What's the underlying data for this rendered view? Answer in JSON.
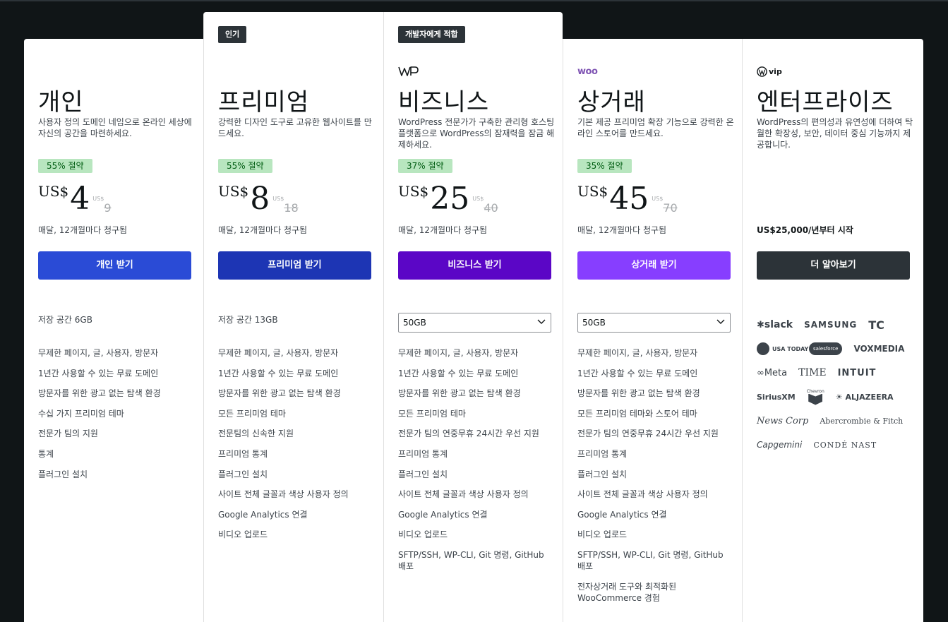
{
  "plans": [
    {
      "badge": "",
      "name": "개인",
      "description": "사용자 정의 도메인 네임으로 온라인 세상에 자신의 공간을 마련하세요.",
      "savings": "55% 절약",
      "currency": "US$",
      "price": "4",
      "old_currency": "US$",
      "old_price": "9",
      "billing": "매달, 12개월마다 청구됨",
      "cta": "개인 받기",
      "cta_color": "#2a4bd6",
      "storage": "저장 공간 6GB",
      "features": [
        "무제한 페이지, 글, 사용자, 방문자",
        "1년간 사용할 수 있는 무료 도메인",
        "방문자를 위한 광고 없는 탐색 환경",
        "수십 가지 프리미엄 테마",
        "전문가 팀의 지원",
        "통계",
        "플러그인 설치"
      ]
    },
    {
      "badge": "인기",
      "name": "프리미엄",
      "description": "강력한 디자인 도구로 고유한 웹사이트를 만드세요.",
      "savings": "55% 절약",
      "currency": "US$",
      "price": "8",
      "old_currency": "US$",
      "old_price": "18",
      "billing": "매달, 12개월마다 청구됨",
      "cta": "프리미엄 받기",
      "cta_color": "#1d35b4",
      "storage": "저장 공간 13GB",
      "features": [
        "무제한 페이지, 글, 사용자, 방문자",
        "1년간 사용할 수 있는 무료 도메인",
        "방문자를 위한 광고 없는 탐색 환경",
        "모든 프리미엄 테마",
        "전문팀의 신속한 지원",
        "프리미엄 통계",
        "플러그인 설치",
        "사이트 전체 글꼴과 색상 사용자 정의",
        "Google Analytics 연결",
        "비디오 업로드"
      ]
    },
    {
      "badge": "개발자에게 적합",
      "name": "비즈니스",
      "description": "WordPress 전문가가 구축한 관리형 호스팅 플랫폼으로 WordPress의 잠재력을 잠금 해제하세요.",
      "savings": "37% 절약",
      "currency": "US$",
      "price": "25",
      "old_currency": "US$",
      "old_price": "40",
      "billing": "매달, 12개월마다 청구됨",
      "cta": "비즈니스 받기",
      "cta_color": "#5b06c6",
      "storage_select": "50GB",
      "features": [
        "무제한 페이지, 글, 사용자, 방문자",
        "1년간 사용할 수 있는 무료 도메인",
        "방문자를 위한 광고 없는 탐색 환경",
        "모든 프리미엄 테마",
        "전문가 팀의 연중무휴 24시간 우선 지원",
        "프리미엄 통계",
        "플러그인 설치",
        "사이트 전체 글꼴과 색상 사용자 정의",
        "Google Analytics 연결",
        "비디오 업로드",
        "SFTP/SSH, WP-CLI, Git 명령, GitHub 배포"
      ]
    },
    {
      "badge": "",
      "name": "상거래",
      "description": "기본 제공 프리미엄 확장 기능으로 강력한 온라인 스토어를 만드세요.",
      "savings": "35% 절약",
      "currency": "US$",
      "price": "45",
      "old_currency": "US$",
      "old_price": "70",
      "billing": "매달, 12개월마다 청구됨",
      "cta": "상거래 받기",
      "cta_color": "#873eff",
      "storage_select": "50GB",
      "logo": "woo",
      "features": [
        "무제한 페이지, 글, 사용자, 방문자",
        "1년간 사용할 수 있는 무료 도메인",
        "방문자를 위한 광고 없는 탐색 환경",
        "모든 프리미엄 테마와 스토어 테마",
        "전문가 팀의 연중무휴 24시간 우선 지원",
        "프리미엄 통계",
        "플러그인 설치",
        "사이트 전체 글꼴과 색상 사용자 정의",
        "Google Analytics 연결",
        "비디오 업로드",
        "SFTP/SSH, WP-CLI, Git 명령, GitHub 배포",
        "전자상거래 도구와 최적화된 WooCommerce 경험"
      ]
    },
    {
      "badge": "",
      "name": "엔터프라이즈",
      "description": "WordPress의 편의성과 유연성에 더하여 탁월한 확장성, 보안, 데이터 중심 기능까지 제공합니다.",
      "price_text": "US$25,000/년부터 시작",
      "cta": "더 알아보기",
      "cta_color": "#2c3338",
      "logo": "vip",
      "client_logos": [
        [
          "slack",
          "SAMSUNG",
          "TC"
        ],
        [
          "USA TODAY",
          "salesforce",
          "VOXMEDIA"
        ],
        [
          "Meta",
          "TIME",
          "INTUIT"
        ],
        [
          "SiriusXM",
          "Chevron",
          "ALJAZEERA"
        ],
        [
          "News Corp",
          "Abercrombie & Fitch"
        ],
        [
          "Capgemini",
          "CONDÉ NAST"
        ]
      ]
    }
  ]
}
